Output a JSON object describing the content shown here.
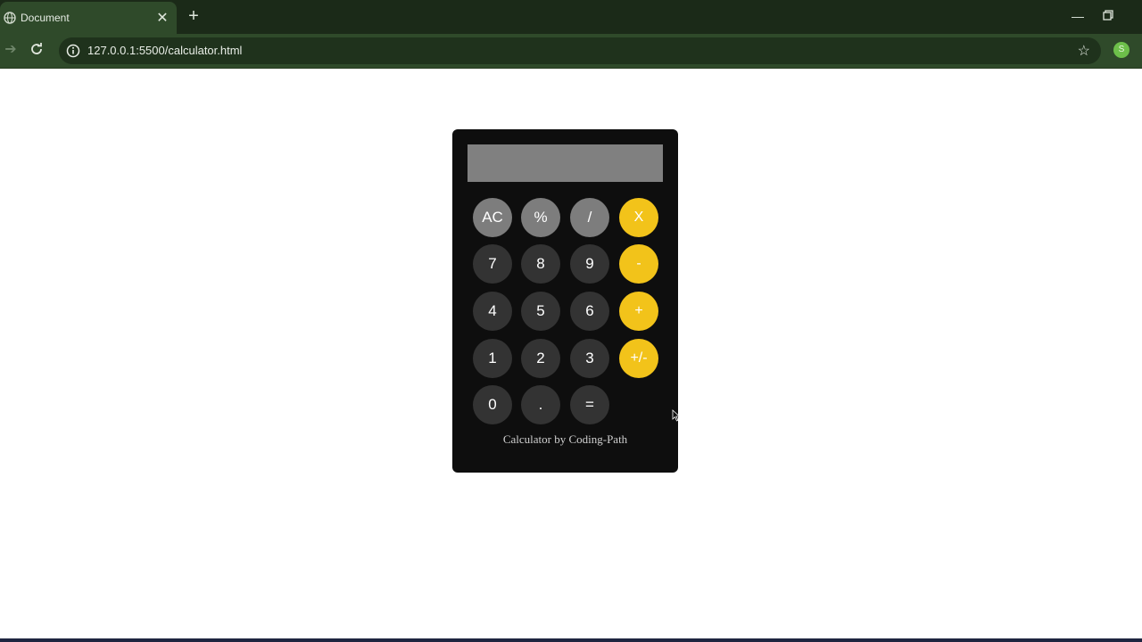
{
  "browser": {
    "tab_title": "Document",
    "tab_close": "✕",
    "new_tab": "+",
    "url": "127.0.0.1:5500/calculator.html",
    "profile_initial": "S",
    "colors": {
      "tabbar": "#1b2a18",
      "toolbar": "#2f4a2a",
      "omnibox": "#1f321c"
    }
  },
  "calculator": {
    "display_value": "",
    "keys": [
      [
        "AC",
        "%",
        "/",
        "X"
      ],
      [
        "7",
        "8",
        "9",
        "-"
      ],
      [
        "4",
        "5",
        "6",
        "+"
      ],
      [
        "1",
        "2",
        "3",
        "+/-"
      ],
      [
        "0",
        ".",
        "="
      ]
    ],
    "credit": "Calculator by Coding-Path",
    "colors": {
      "body": "#0e0e0e",
      "display": "#808080",
      "function_key": "#7d7d7d",
      "number_key": "#333333",
      "operator_key": "#f2c31a"
    }
  }
}
